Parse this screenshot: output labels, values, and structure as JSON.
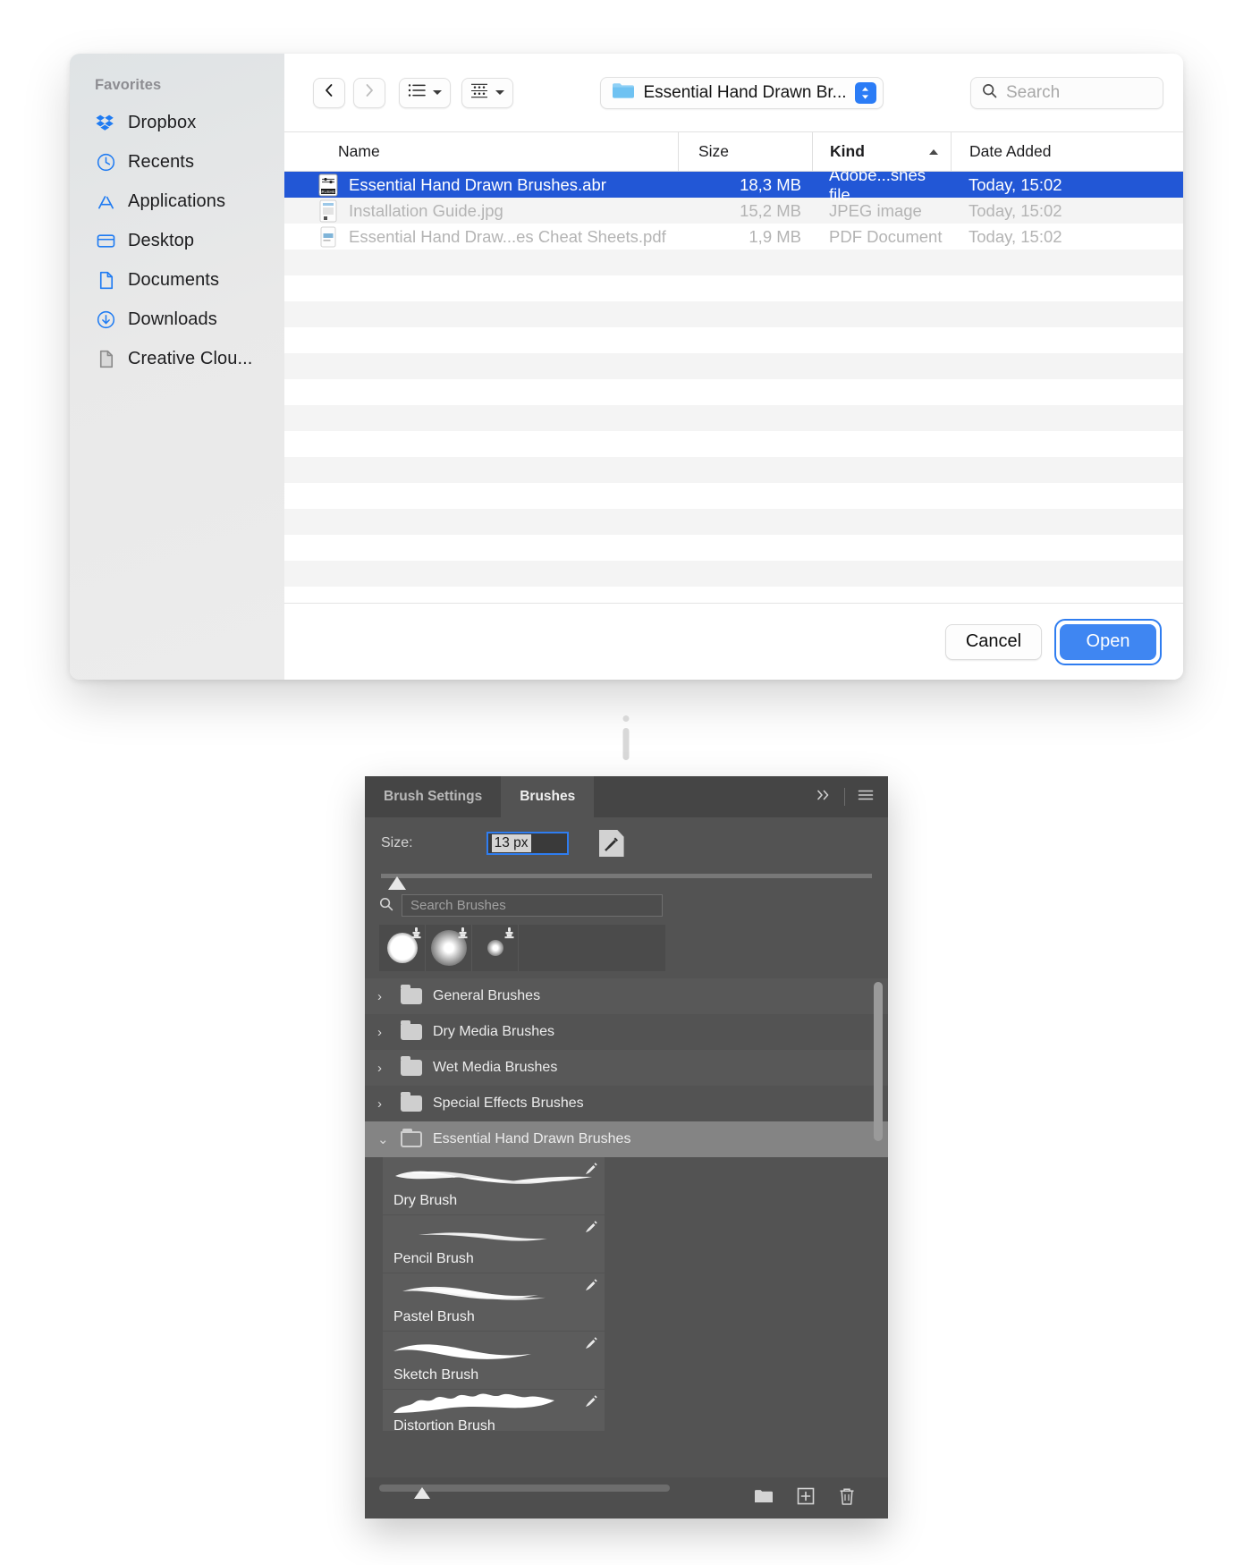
{
  "finder": {
    "sidebar": {
      "title": "Favorites",
      "items": [
        {
          "label": "Dropbox",
          "icon": "dropbox-icon"
        },
        {
          "label": "Recents",
          "icon": "clock-icon"
        },
        {
          "label": "Applications",
          "icon": "appstore-icon"
        },
        {
          "label": "Desktop",
          "icon": "desktop-icon"
        },
        {
          "label": "Documents",
          "icon": "document-icon"
        },
        {
          "label": "Downloads",
          "icon": "download-icon"
        },
        {
          "label": "Creative Clou...",
          "icon": "document-icon"
        }
      ]
    },
    "toolbar": {
      "back_icon": "chevron-left-icon",
      "forward_icon": "chevron-right-icon",
      "view_list_icon": "list-view-icon",
      "view_grid_icon": "grid-view-icon",
      "path_label": "Essential Hand Drawn Br...",
      "path_folder_icon": "folder-icon",
      "stepper_icon": "stepper-updown-icon",
      "search_placeholder": "Search",
      "search_value": "",
      "search_icon": "search-icon"
    },
    "columns": [
      "Name",
      "Size",
      "Kind",
      "Date Added"
    ],
    "sort_column": "Kind",
    "rows": [
      {
        "name": "Essential Hand Drawn Brushes.abr",
        "size": "18,3 MB",
        "kind": "Adobe...shes file",
        "date": "Today, 15:02",
        "selected": true,
        "icon": "abr-file-icon"
      },
      {
        "name": "Installation Guide.jpg",
        "size": "15,2 MB",
        "kind": "JPEG image",
        "date": "Today, 15:02",
        "selected": false,
        "icon": "jpg-file-icon"
      },
      {
        "name": "Essential Hand Draw...es Cheat Sheets.pdf",
        "size": "1,9 MB",
        "kind": "PDF Document",
        "date": "Today, 15:02",
        "selected": false,
        "icon": "pdf-file-icon"
      }
    ],
    "footer": {
      "cancel_label": "Cancel",
      "open_label": "Open"
    },
    "colors": {
      "selection_blue": "#2257d6",
      "accent_blue": "#3f86f2"
    }
  },
  "photoshop": {
    "tabs": [
      {
        "label": "Brush Settings",
        "active": false
      },
      {
        "label": "Brushes",
        "active": true
      }
    ],
    "tab_overflow_icon": "chevrons-right-icon",
    "panel_menu_icon": "hamburger-menu-icon",
    "size": {
      "label": "Size:",
      "value": "13 px",
      "slider_percent": 3,
      "brush_tip_icon": "brush-preset-icon"
    },
    "search": {
      "placeholder": "Search Brushes",
      "value": "",
      "icon": "search-icon"
    },
    "presets": [
      {
        "name": "soft-round-large",
        "size": 34,
        "blur": 3
      },
      {
        "name": "soft-round-medium",
        "size": 36,
        "blur": 9
      },
      {
        "name": "soft-round-small",
        "size": 16,
        "blur": 5
      }
    ],
    "folders": [
      {
        "label": "General Brushes",
        "expanded": false,
        "selected": false
      },
      {
        "label": "Dry Media Brushes",
        "expanded": false,
        "selected": false
      },
      {
        "label": "Wet Media Brushes",
        "expanded": false,
        "selected": false
      },
      {
        "label": "Special Effects Brushes",
        "expanded": false,
        "selected": false
      },
      {
        "label": "Essential Hand Drawn Brushes",
        "expanded": true,
        "selected": true
      }
    ],
    "brushes": [
      {
        "label": "Dry Brush"
      },
      {
        "label": "Pencil Brush"
      },
      {
        "label": "Pastel Brush"
      },
      {
        "label": "Sketch Brush"
      },
      {
        "label": "Distortion Brush"
      }
    ],
    "bottom_icons": [
      "new-folder-icon",
      "new-brush-icon",
      "delete-brush-icon"
    ],
    "colors": {
      "panel_bg": "#535353",
      "tab_bg": "#454545",
      "row_selected": "#848484",
      "field_border_blue": "#2f7df0"
    }
  }
}
